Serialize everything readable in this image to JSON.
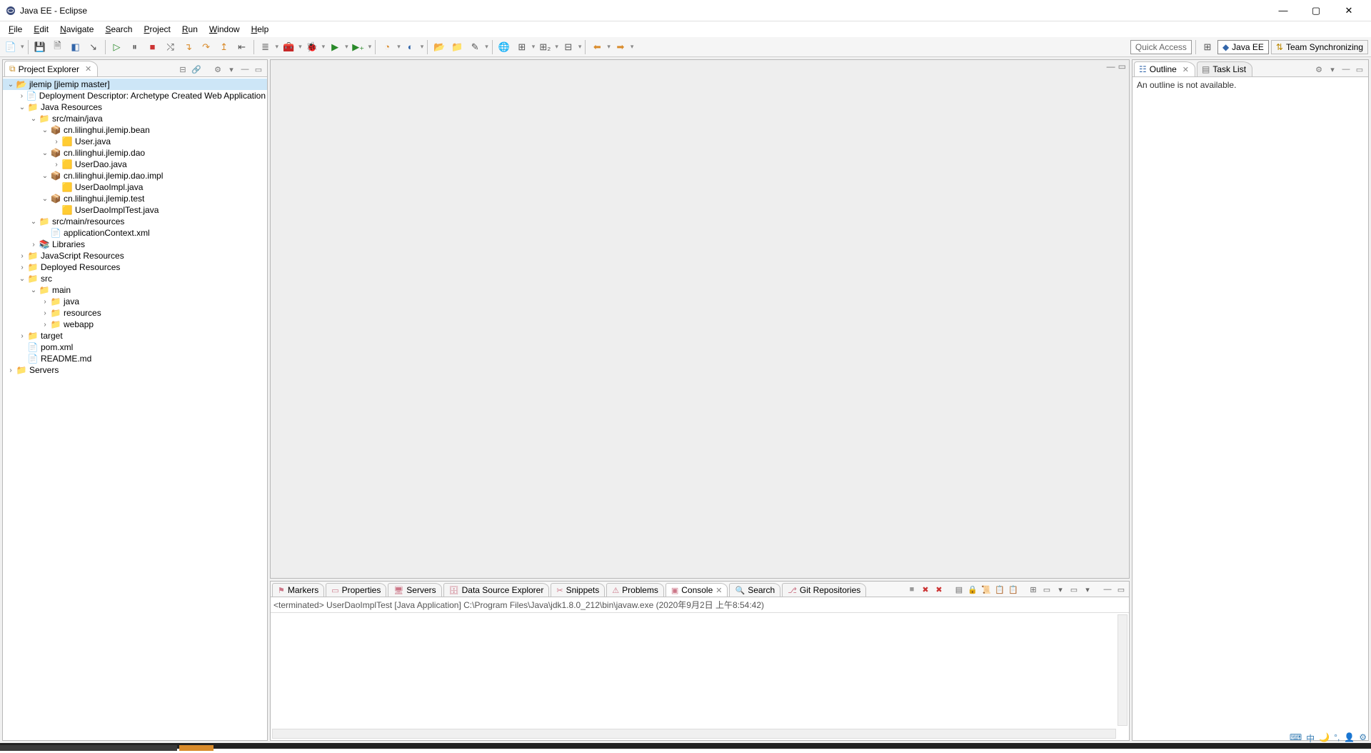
{
  "title": "Java EE - Eclipse",
  "menu": [
    "File",
    "Edit",
    "Navigate",
    "Search",
    "Project",
    "Run",
    "Window",
    "Help"
  ],
  "toolbar_right": {
    "quick_access": "Quick Access",
    "perspectives": [
      "Java EE",
      "Team Synchronizing"
    ]
  },
  "project_explorer": {
    "title": "Project Explorer",
    "tree": [
      {
        "d": 0,
        "e": "v",
        "i": "proj",
        "t": "jlemip  [jlemip master]",
        "sel": true
      },
      {
        "d": 1,
        "e": ">",
        "i": "file",
        "t": "Deployment Descriptor: Archetype Created Web Application"
      },
      {
        "d": 1,
        "e": "v",
        "i": "folder",
        "t": "Java Resources"
      },
      {
        "d": 2,
        "e": "v",
        "i": "folder",
        "t": "src/main/java"
      },
      {
        "d": 3,
        "e": "v",
        "i": "package",
        "t": "cn.lilinghui.jlemip.bean"
      },
      {
        "d": 4,
        "e": ">",
        "i": "java",
        "t": "User.java"
      },
      {
        "d": 3,
        "e": "v",
        "i": "package",
        "t": "cn.lilinghui.jlemip.dao"
      },
      {
        "d": 4,
        "e": ">",
        "i": "java",
        "t": "UserDao.java"
      },
      {
        "d": 3,
        "e": "v",
        "i": "package",
        "t": "cn.lilinghui.jlemip.dao.impl"
      },
      {
        "d": 4,
        "e": "",
        "i": "java",
        "t": "UserDaoImpl.java"
      },
      {
        "d": 3,
        "e": "v",
        "i": "package",
        "t": "cn.lilinghui.jlemip.test"
      },
      {
        "d": 4,
        "e": "",
        "i": "java",
        "t": "UserDaoImplTest.java"
      },
      {
        "d": 2,
        "e": "v",
        "i": "folder",
        "t": "src/main/resources"
      },
      {
        "d": 3,
        "e": "",
        "i": "xml",
        "t": "applicationContext.xml"
      },
      {
        "d": 2,
        "e": ">",
        "i": "lib",
        "t": "Libraries"
      },
      {
        "d": 1,
        "e": ">",
        "i": "folder",
        "t": "JavaScript Resources"
      },
      {
        "d": 1,
        "e": ">",
        "i": "folder",
        "t": "Deployed Resources"
      },
      {
        "d": 1,
        "e": "v",
        "i": "folder",
        "t": "src"
      },
      {
        "d": 2,
        "e": "v",
        "i": "folder",
        "t": "main"
      },
      {
        "d": 3,
        "e": ">",
        "i": "folder",
        "t": "java"
      },
      {
        "d": 3,
        "e": ">",
        "i": "folder",
        "t": "resources"
      },
      {
        "d": 3,
        "e": ">",
        "i": "folder",
        "t": "webapp"
      },
      {
        "d": 1,
        "e": ">",
        "i": "folder",
        "t": "target"
      },
      {
        "d": 1,
        "e": "",
        "i": "xml",
        "t": "pom.xml"
      },
      {
        "d": 1,
        "e": "",
        "i": "file",
        "t": "README.md"
      },
      {
        "d": 0,
        "e": ">",
        "i": "folder",
        "t": "Servers"
      }
    ]
  },
  "outline": {
    "title": "Outline",
    "task_list": "Task List",
    "empty": "An outline is not available."
  },
  "bottom": {
    "tabs": [
      "Markers",
      "Properties",
      "Servers",
      "Data Source Explorer",
      "Snippets",
      "Problems",
      "Console",
      "Search",
      "Git Repositories"
    ],
    "active": 6,
    "console_header": "<terminated> UserDaoImplTest [Java Application] C:\\Program Files\\Java\\jdk1.8.0_212\\bin\\javaw.exe (2020年9月2日 上午8:54:42)"
  }
}
